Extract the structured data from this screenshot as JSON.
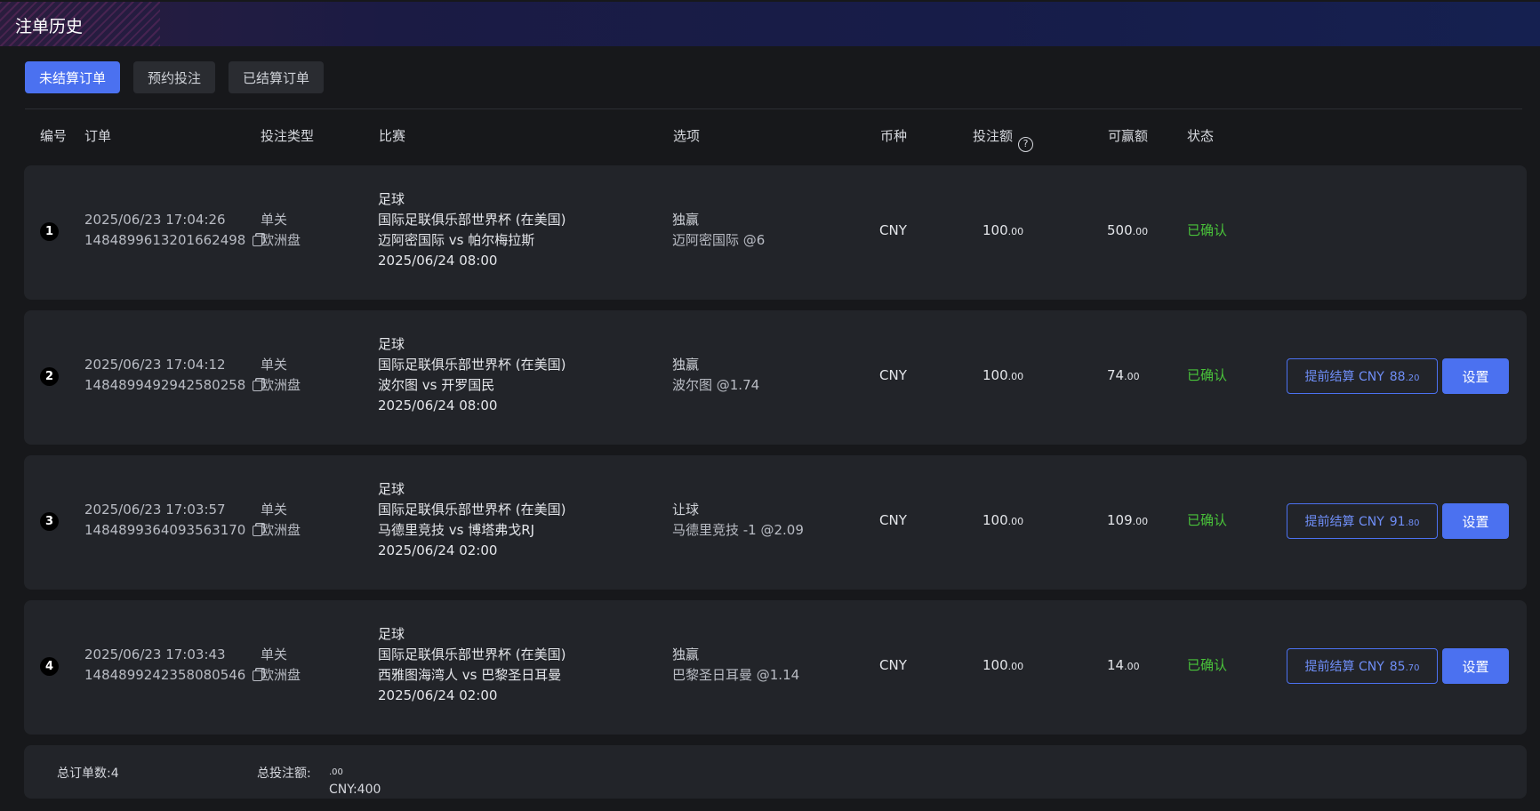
{
  "header": {
    "title": "注单历史"
  },
  "tabs": [
    {
      "label": "未结算订单",
      "active": true
    },
    {
      "label": "预约投注",
      "active": false
    },
    {
      "label": "已结算订单",
      "active": false
    }
  ],
  "columns": {
    "num": "编号",
    "order": "订单",
    "type": "投注类型",
    "match": "比赛",
    "option": "选项",
    "currency": "币种",
    "stake": "投注额",
    "win": "可赢额",
    "status": "状态"
  },
  "colors": {
    "accent": "#4b71f0",
    "status_confirmed": "#49c23a",
    "background": "#17181b",
    "row": "#222429"
  },
  "rows": [
    {
      "num": "1",
      "time": "2025/06/23 17:04:26",
      "order_id": "1484899613201662498",
      "type": "单关",
      "odds_type": "欧洲盘",
      "sport": "足球",
      "league": "国际足联俱乐部世界杯 (在美国)",
      "teams": "迈阿密国际 vs 帕尔梅拉斯",
      "match_time": "2025/06/24 08:00",
      "option": "独赢",
      "selection": "迈阿密国际 @6",
      "currency": "CNY",
      "stake": "100",
      "stake_dec": ".00",
      "win": "500",
      "win_dec": ".00",
      "status": "已确认"
    },
    {
      "num": "2",
      "time": "2025/06/23 17:04:12",
      "order_id": "1484899492942580258",
      "type": "单关",
      "odds_type": "欧洲盘",
      "sport": "足球",
      "league": "国际足联俱乐部世界杯 (在美国)",
      "teams": "波尔图 vs 开罗国民",
      "match_time": "2025/06/24 08:00",
      "option": "独赢",
      "selection": "波尔图 @1.74",
      "currency": "CNY",
      "stake": "100",
      "stake_dec": ".00",
      "win": "74",
      "win_dec": ".00",
      "status": "已确认",
      "cashout_label": "提前结算 CNY",
      "cashout_amount": "88",
      "cashout_dec": ".20",
      "settle_label": "设置"
    },
    {
      "num": "3",
      "time": "2025/06/23 17:03:57",
      "order_id": "1484899364093563170",
      "type": "单关",
      "odds_type": "欧洲盘",
      "sport": "足球",
      "league": "国际足联俱乐部世界杯 (在美国)",
      "teams": "马德里竞技 vs 博塔弗戈RJ",
      "match_time": "2025/06/24 02:00",
      "option": "让球",
      "selection": "马德里竞技 -1 @2.09",
      "currency": "CNY",
      "stake": "100",
      "stake_dec": ".00",
      "win": "109",
      "win_dec": ".00",
      "status": "已确认",
      "cashout_label": "提前结算 CNY",
      "cashout_amount": "91",
      "cashout_dec": ".80",
      "settle_label": "设置"
    },
    {
      "num": "4",
      "time": "2025/06/23 17:03:43",
      "order_id": "1484899242358080546",
      "type": "单关",
      "odds_type": "欧洲盘",
      "sport": "足球",
      "league": "国际足联俱乐部世界杯 (在美国)",
      "teams": "西雅图海湾人 vs 巴黎圣日耳曼",
      "match_time": "2025/06/24 02:00",
      "option": "独赢",
      "selection": "巴黎圣日耳曼 @1.14",
      "currency": "CNY",
      "stake": "100",
      "stake_dec": ".00",
      "win": "14",
      "win_dec": ".00",
      "status": "已确认",
      "cashout_label": "提前结算 CNY",
      "cashout_amount": "85",
      "cashout_dec": ".70",
      "settle_label": "设置"
    }
  ],
  "footer": {
    "total_orders": "总订单数:4",
    "total_stake_label": "总投注额:",
    "total_stake_value": "CNY:400",
    "total_stake_dec": ".00"
  }
}
